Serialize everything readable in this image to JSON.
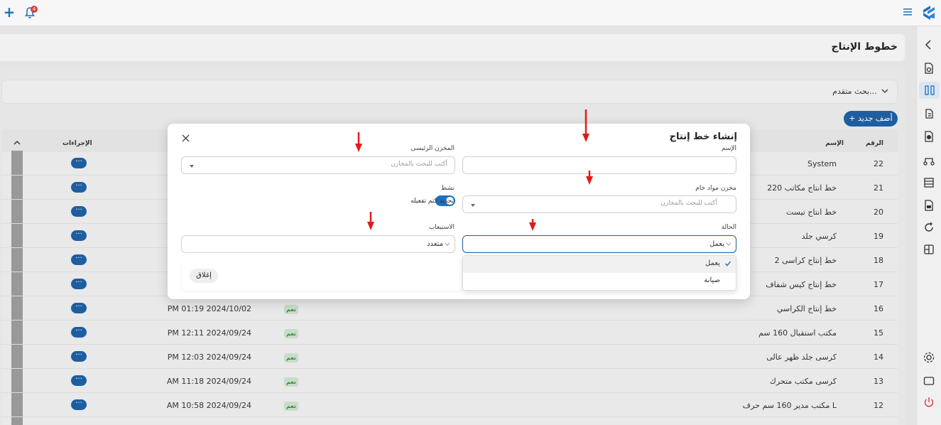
{
  "topbar": {
    "notification_count": "4"
  },
  "page": {
    "title": "خطوط الإنتاج"
  },
  "toolbar": {
    "advanced_search_label": "بحث متقدم...",
    "add_new_label": "أضف جديد"
  },
  "table": {
    "headers": {
      "number": "الرقم",
      "name": "الإسم",
      "actions": "الإجراءات"
    },
    "action_label": "···",
    "rows": [
      {
        "number": "22",
        "name": "System",
        "date": "",
        "active": ""
      },
      {
        "number": "21",
        "name": "خط انتاج مكاتب 220",
        "date": "",
        "active": ""
      },
      {
        "number": "20",
        "name": "خط انتاج تيست",
        "date": "",
        "active": ""
      },
      {
        "number": "19",
        "name": "كرسي جلد",
        "date": "",
        "active": ""
      },
      {
        "number": "18",
        "name": "خط إنتاج كراسى 2",
        "date": "",
        "active": ""
      },
      {
        "number": "17",
        "name": "خط إنتاج كيس شفاف",
        "date": "",
        "active": ""
      },
      {
        "number": "16",
        "name": "خط إنتاج الكراسي",
        "date": "PM 01:19 2024/10/02",
        "active": "نعم"
      },
      {
        "number": "15",
        "name": "مكتب استقبال 160 سم",
        "date": "PM 12:11 2024/09/24",
        "active": "نعم"
      },
      {
        "number": "14",
        "name": "كرسى جلد ظهر عالى",
        "date": "PM 12:03 2024/09/24",
        "active": "نعم"
      },
      {
        "number": "13",
        "name": "كرسى مكتب متحرك",
        "date": "AM 11:18 2024/09/24",
        "active": "نعم"
      },
      {
        "number": "12",
        "name": "مكتب مدير 160 سم حرف L",
        "date": "AM 10:58 2024/09/24",
        "active": "نعم"
      }
    ]
  },
  "modal": {
    "title": "إنشاء خط إنتاج",
    "fields": {
      "name_label": "الإسم",
      "main_warehouse_label": "المخزن الرئيسى",
      "main_warehouse_placeholder": "أكتب للبحث بالمخازن",
      "raw_warehouse_label": "مخزن مواد خام",
      "raw_warehouse_placeholder": "أكتب للبحث بالمخازن",
      "active_label": "نشط",
      "active_toggle_text": "تحديد كتم تفعيله",
      "status_label": "الحالة",
      "status_value": "يعمل",
      "capacity_label": "الاستيعاب",
      "capacity_value": "متعدد"
    },
    "close_button": "إغلاق",
    "status_options": [
      {
        "label": "يعمل",
        "selected": true
      },
      {
        "label": "صيانة",
        "selected": false
      }
    ]
  },
  "colors": {
    "primary": "#1e5ea0",
    "annotation": "#e11b1b",
    "badge_green": "#2e8b3e"
  }
}
